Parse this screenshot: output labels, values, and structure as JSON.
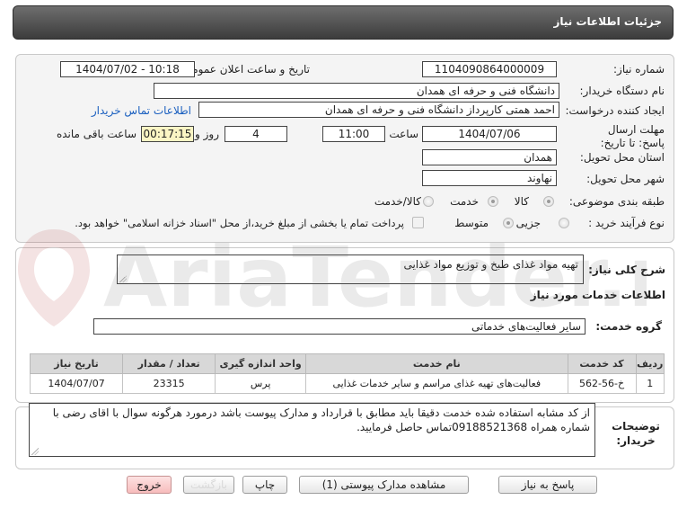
{
  "header": {
    "title": "جزئیات اطلاعات نیاز"
  },
  "form": {
    "need_number_label": "شماره نیاز:",
    "need_number": "1104090864000009",
    "announce_label": "تاریخ و ساعت اعلان عمومی:",
    "announce_value": "1404/07/02 - 10:18",
    "buyer_org_label": "نام دستگاه خریدار:",
    "buyer_org": "دانشگاه فنی و حرفه ای همدان",
    "creator_label": "ایجاد کننده درخواست:",
    "creator": "احمد  همتی کارپرداز دانشگاه فنی و حرفه ای همدان",
    "contact_link": "اطلاعات تماس خریدار",
    "deadline_label": "مهلت ارسال پاسخ: تا تاریخ:",
    "deadline_date": "1404/07/06",
    "time_label": "ساعت",
    "deadline_time": "11:00",
    "days_value": "4",
    "days_label": "روز و",
    "remaining_value": "00:17:15",
    "remaining_label": "ساعت باقی مانده",
    "province_label": "استان محل تحویل:",
    "province": "همدان",
    "city_label": "شهر محل تحویل:",
    "city": "نهاوند",
    "category_label": "طبقه بندی موضوعی:",
    "category_options": [
      "کالا",
      "خدمت",
      "کالا/خدمت"
    ],
    "process_label": "نوع فرآیند خرید :",
    "process_options": [
      "جزیی",
      "متوسط"
    ],
    "payment_text": "پرداخت تمام یا بخشی از مبلغ خرید،از محل \"اسناد خزانه اسلامی\" خواهد بود."
  },
  "summary": {
    "label": "شرح کلی نیاز:",
    "value": "تهیه مواد غذای طبخ و توزیع مواد غذایی"
  },
  "services": {
    "section_title": "اطلاعات خدمات مورد نیاز",
    "group_label": "گروه خدمت:",
    "group_value": "سایر فعالیت‌های خدماتی",
    "columns": [
      "ردیف",
      "کد خدمت",
      "نام خدمت",
      "واحد اندازه گیری",
      "تعداد / مقدار",
      "تاریخ نیاز"
    ],
    "rows": [
      [
        "1",
        "خ-56-562",
        "فعالیت‌های تهیه غذای مراسم و سایر خدمات غذایی",
        "پرس",
        "23315",
        "1404/07/07"
      ]
    ]
  },
  "buyer_notes": {
    "label": "توضیحات خریدار:",
    "text": "از کد مشابه استفاده شده خدمت دقیقا باید مطابق با قرارداد و مدارک پیوست باشد درمورد هرگونه سوال با اقای رضی با شماره همراه 09188521368تماس حاصل فرمایید."
  },
  "buttons": {
    "reply": "پاسخ به نیاز",
    "attachments": "مشاهده مدارک پیوستی (1)",
    "print": "چاپ",
    "back": "بازگشت",
    "exit": "خروج"
  },
  "watermark": {
    "text": "AriaTender.net"
  },
  "colors": {
    "header": "#4a4a4a",
    "link": "#1a5fbf",
    "remaining_bg": "#fbf5c4",
    "exit_button": "#f7bcbc"
  }
}
